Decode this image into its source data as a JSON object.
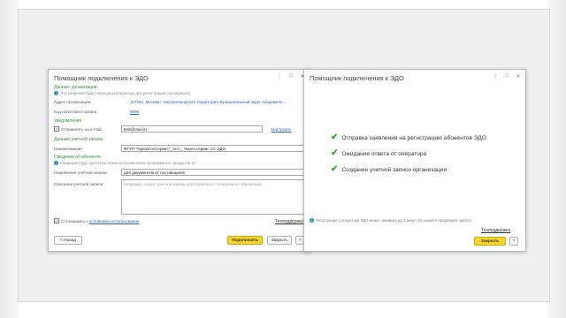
{
  "left_window": {
    "title": "Помощник подключения к ЭДО",
    "controls": [
      "⋮",
      "□",
      "✕"
    ],
    "section_org": "Данные организации",
    "note_org": "Эти сведения будут переданы оператору для регистрации сертификата",
    "address_label": "Адрес организации",
    "address_value": "117252, Москва г, внутригородская территория муниципальный округ Академиче...",
    "tax_label": "Код налогового органа",
    "tax_value": "9999",
    "section_notify": "Уведомления",
    "email_checkbox_label": "Отправлять на e-mail:",
    "email_value": "test@mail.ru",
    "email_action": "Настроить",
    "section_account": "Данные учетной записи",
    "name_label": "Наименование",
    "name_value": "ФГУП \"ОрвэкГосСервис\"_тест_ Через сервис 1С-ЭДО",
    "section_subscriber": "Сведения об абоненте",
    "note_subscriber": "Сведения будут доступны всем пользователям программных продуктов 1С",
    "purpose_label": "Назначение учетной записи:",
    "purpose_value": "для документов от поставщиков",
    "description_label": "Описание учетной записи:",
    "description_placeholder": "Например, запрет учетной записи для служебного телефонного обращения...",
    "agree_text": "Соглашаюсь с",
    "agree_link": "условиями использования",
    "help_link": "Техподдержка",
    "back_button": "< Назад",
    "connect_button": "Подключить",
    "close_button": "Закрыть",
    "help_button": "?"
  },
  "right_window": {
    "title": "Помощник подключения к ЭДО",
    "controls": [
      "⋮",
      "□",
      "✕"
    ],
    "tasks": [
      "Отправка заявления на регистрацию абонентов ЭДО",
      "Ожидание ответа от оператора",
      "Создание учетной записи организации"
    ],
    "footnote": "Регистрация у оператора ЭДО может занимать до 2 минут. Вы можете продолжить работу",
    "help_link": "Техподдержка",
    "close_button": "Закрыть",
    "help_button": "?"
  },
  "colors": {
    "accent_green": "#3f9a3f",
    "primary_button": "#f6d62b",
    "link": "#2d5fa8",
    "arrow": "#c0392b"
  }
}
